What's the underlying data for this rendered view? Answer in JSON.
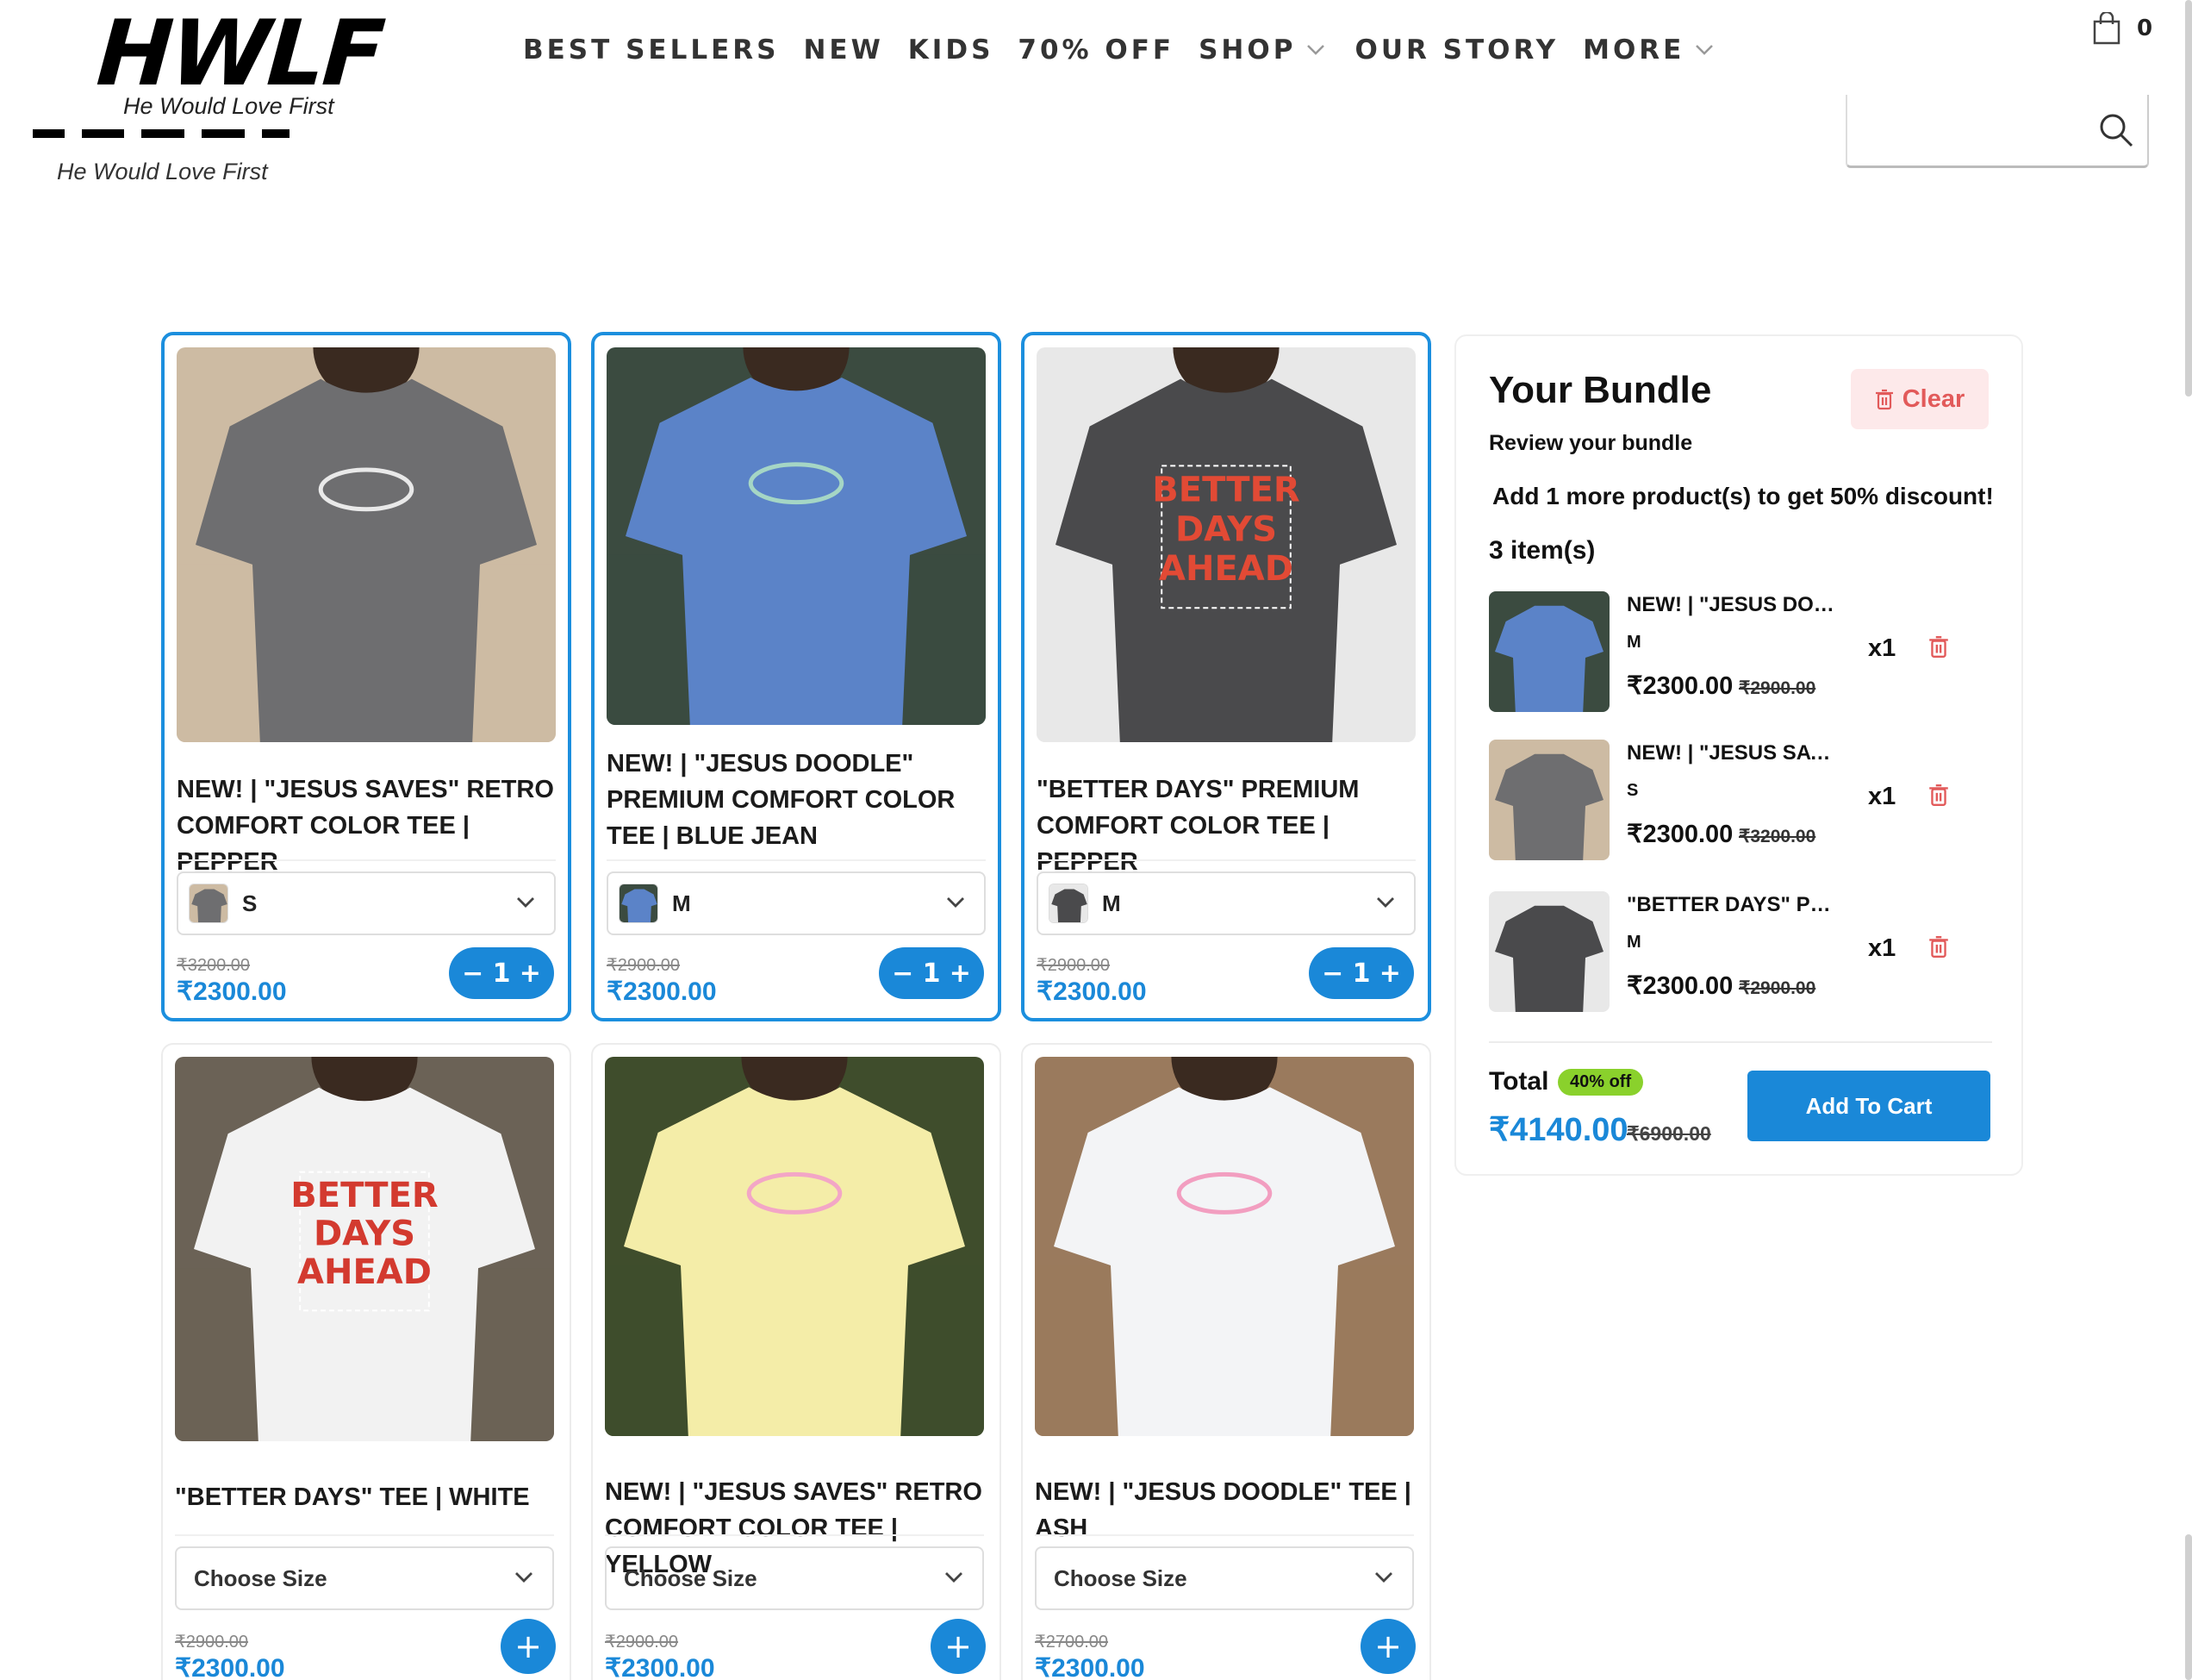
{
  "header": {
    "logo_text": "HWLF",
    "logo_tagline": "He Would Love First",
    "nav": [
      "BEST SELLERS",
      "NEW",
      "KIDS",
      "70% OFF",
      "SHOP",
      "OUR STORY",
      "MORE"
    ],
    "cart_count": "0"
  },
  "colors": {
    "accent": "#1a88d8",
    "badge": "#8ad12c",
    "danger": "#e25a5a"
  },
  "products": [
    {
      "title": "NEW! | \"JESUS SAVES\" RETRO COMFORT COLOR TEE | PEPPER",
      "size": "S",
      "old_price": "₹3200.00",
      "price": "₹2300.00",
      "qty_minus": "−",
      "qty": "1",
      "qty_plus": "+",
      "shirt": "#6e6e70",
      "bg": "#cdbba3",
      "print": "#e9e9e9",
      "print_text": ""
    },
    {
      "title": "NEW! | \"JESUS DOODLE\" PREMIUM COMFORT COLOR TEE | BLUE JEAN",
      "size": "M",
      "old_price": "₹2900.00",
      "price": "₹2300.00",
      "qty_minus": "−",
      "qty": "1",
      "qty_plus": "+",
      "shirt": "#5b83c8",
      "bg": "#3b4b40",
      "print": "#a5d6c5",
      "print_text": ""
    },
    {
      "title": "\"BETTER DAYS\" PREMIUM COMFORT COLOR TEE | PEPPER",
      "size": "M",
      "old_price": "₹2900.00",
      "price": "₹2300.00",
      "qty_minus": "−",
      "qty": "1",
      "qty_plus": "+",
      "shirt": "#4a4a4c",
      "bg": "#e8e8e8",
      "print": "#e24a35",
      "print_text": "BETTER DAYS AHEAD"
    },
    {
      "title": "\"BETTER DAYS\" TEE | WHITE",
      "choose": "Choose Size",
      "old_price": "₹2900.00",
      "price": "₹2300.00",
      "add": "+",
      "shirt": "#f2f2f2",
      "bg": "#6b6256",
      "print": "#d33a2f",
      "print_text": "BETTER DAYS AHEAD"
    },
    {
      "title": "NEW! | \"JESUS SAVES\" RETRO COMFORT COLOR TEE | YELLOW",
      "choose": "Choose Size",
      "old_price": "₹2900.00",
      "price": "₹2300.00",
      "add": "+",
      "shirt": "#f4eda8",
      "bg": "#3f4d2c",
      "print": "#f3a6c6",
      "print_text": ""
    },
    {
      "title": "NEW! | \"JESUS DOODLE\" TEE | ASH",
      "choose": "Choose Size",
      "old_price": "₹2700.00",
      "price": "₹2300.00",
      "add": "+",
      "shirt": "#f3f4f6",
      "bg": "#9a7a5d",
      "print": "#f29ec0",
      "print_text": ""
    }
  ],
  "bundle": {
    "title": "Your Bundle",
    "clear": "Clear",
    "subtitle": "Review your bundle",
    "message": "Add 1 more product(s) to get 50% discount!",
    "count": "3 item(s)",
    "items": [
      {
        "name": "NEW! | \"JESUS DOO...",
        "size": "M",
        "price": "₹2300.00",
        "old": "₹2900.00",
        "qty": "x1",
        "shirt": "#5b83c8",
        "bg": "#3b4b40"
      },
      {
        "name": "NEW! | \"JESUS SAVE...",
        "size": "S",
        "price": "₹2300.00",
        "old": "₹3200.00",
        "qty": "x1",
        "shirt": "#6e6e70",
        "bg": "#cdbba3"
      },
      {
        "name": "\"BETTER DAYS\" PRE...",
        "size": "M",
        "price": "₹2300.00",
        "old": "₹2900.00",
        "qty": "x1",
        "shirt": "#4a4a4c",
        "bg": "#e8e8e8"
      }
    ],
    "total_label": "Total",
    "badge": "40% off",
    "total": "₹4140.00",
    "total_old": "₹6900.00",
    "add_to_cart": "Add To Cart"
  }
}
